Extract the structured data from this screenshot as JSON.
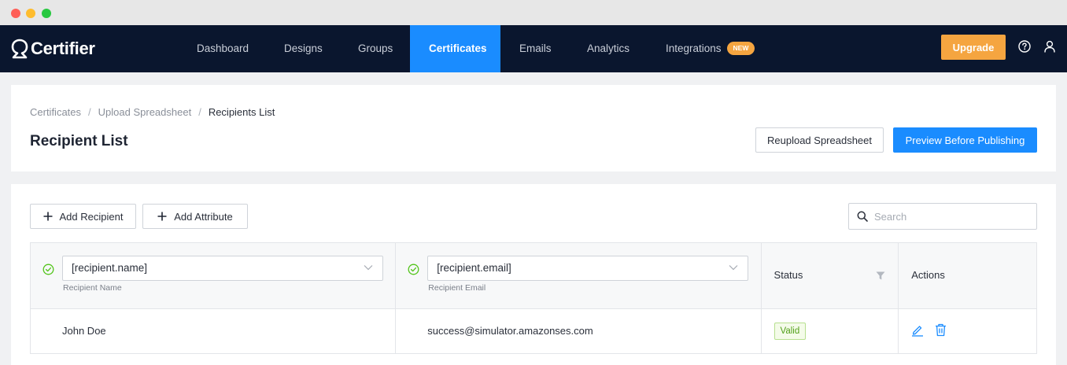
{
  "app": {
    "name": "Certifier"
  },
  "nav": {
    "items": [
      {
        "label": "Dashboard",
        "active": false
      },
      {
        "label": "Designs",
        "active": false
      },
      {
        "label": "Groups",
        "active": false
      },
      {
        "label": "Certificates",
        "active": true
      },
      {
        "label": "Emails",
        "active": false
      },
      {
        "label": "Analytics",
        "active": false
      },
      {
        "label": "Integrations",
        "active": false,
        "badge": "NEW"
      }
    ],
    "upgrade_label": "Upgrade",
    "help_icon": "help-circle-icon",
    "user_icon": "user-icon"
  },
  "breadcrumb": [
    "Certificates",
    "Upload Spreadsheet",
    "Recipients List"
  ],
  "page": {
    "title": "Recipient List",
    "reupload_label": "Reupload Spreadsheet",
    "preview_label": "Preview Before Publishing"
  },
  "toolbar": {
    "add_recipient_label": "Add Recipient",
    "add_attribute_label": "Add Attribute",
    "search_placeholder": "Search"
  },
  "table": {
    "columns": [
      {
        "mapping": "[recipient.name]",
        "label": "Recipient Name"
      },
      {
        "mapping": "[recipient.email]",
        "label": "Recipient Email"
      },
      {
        "label": "Status"
      },
      {
        "label": "Actions"
      }
    ],
    "rows": [
      {
        "name": "John Doe",
        "email": "success@simulator.amazonses.com",
        "status": "Valid"
      }
    ]
  },
  "colors": {
    "nav_bg": "#0a162e",
    "accent": "#1a8cff",
    "upgrade": "#f5a540",
    "valid_green": "#52a01a"
  }
}
